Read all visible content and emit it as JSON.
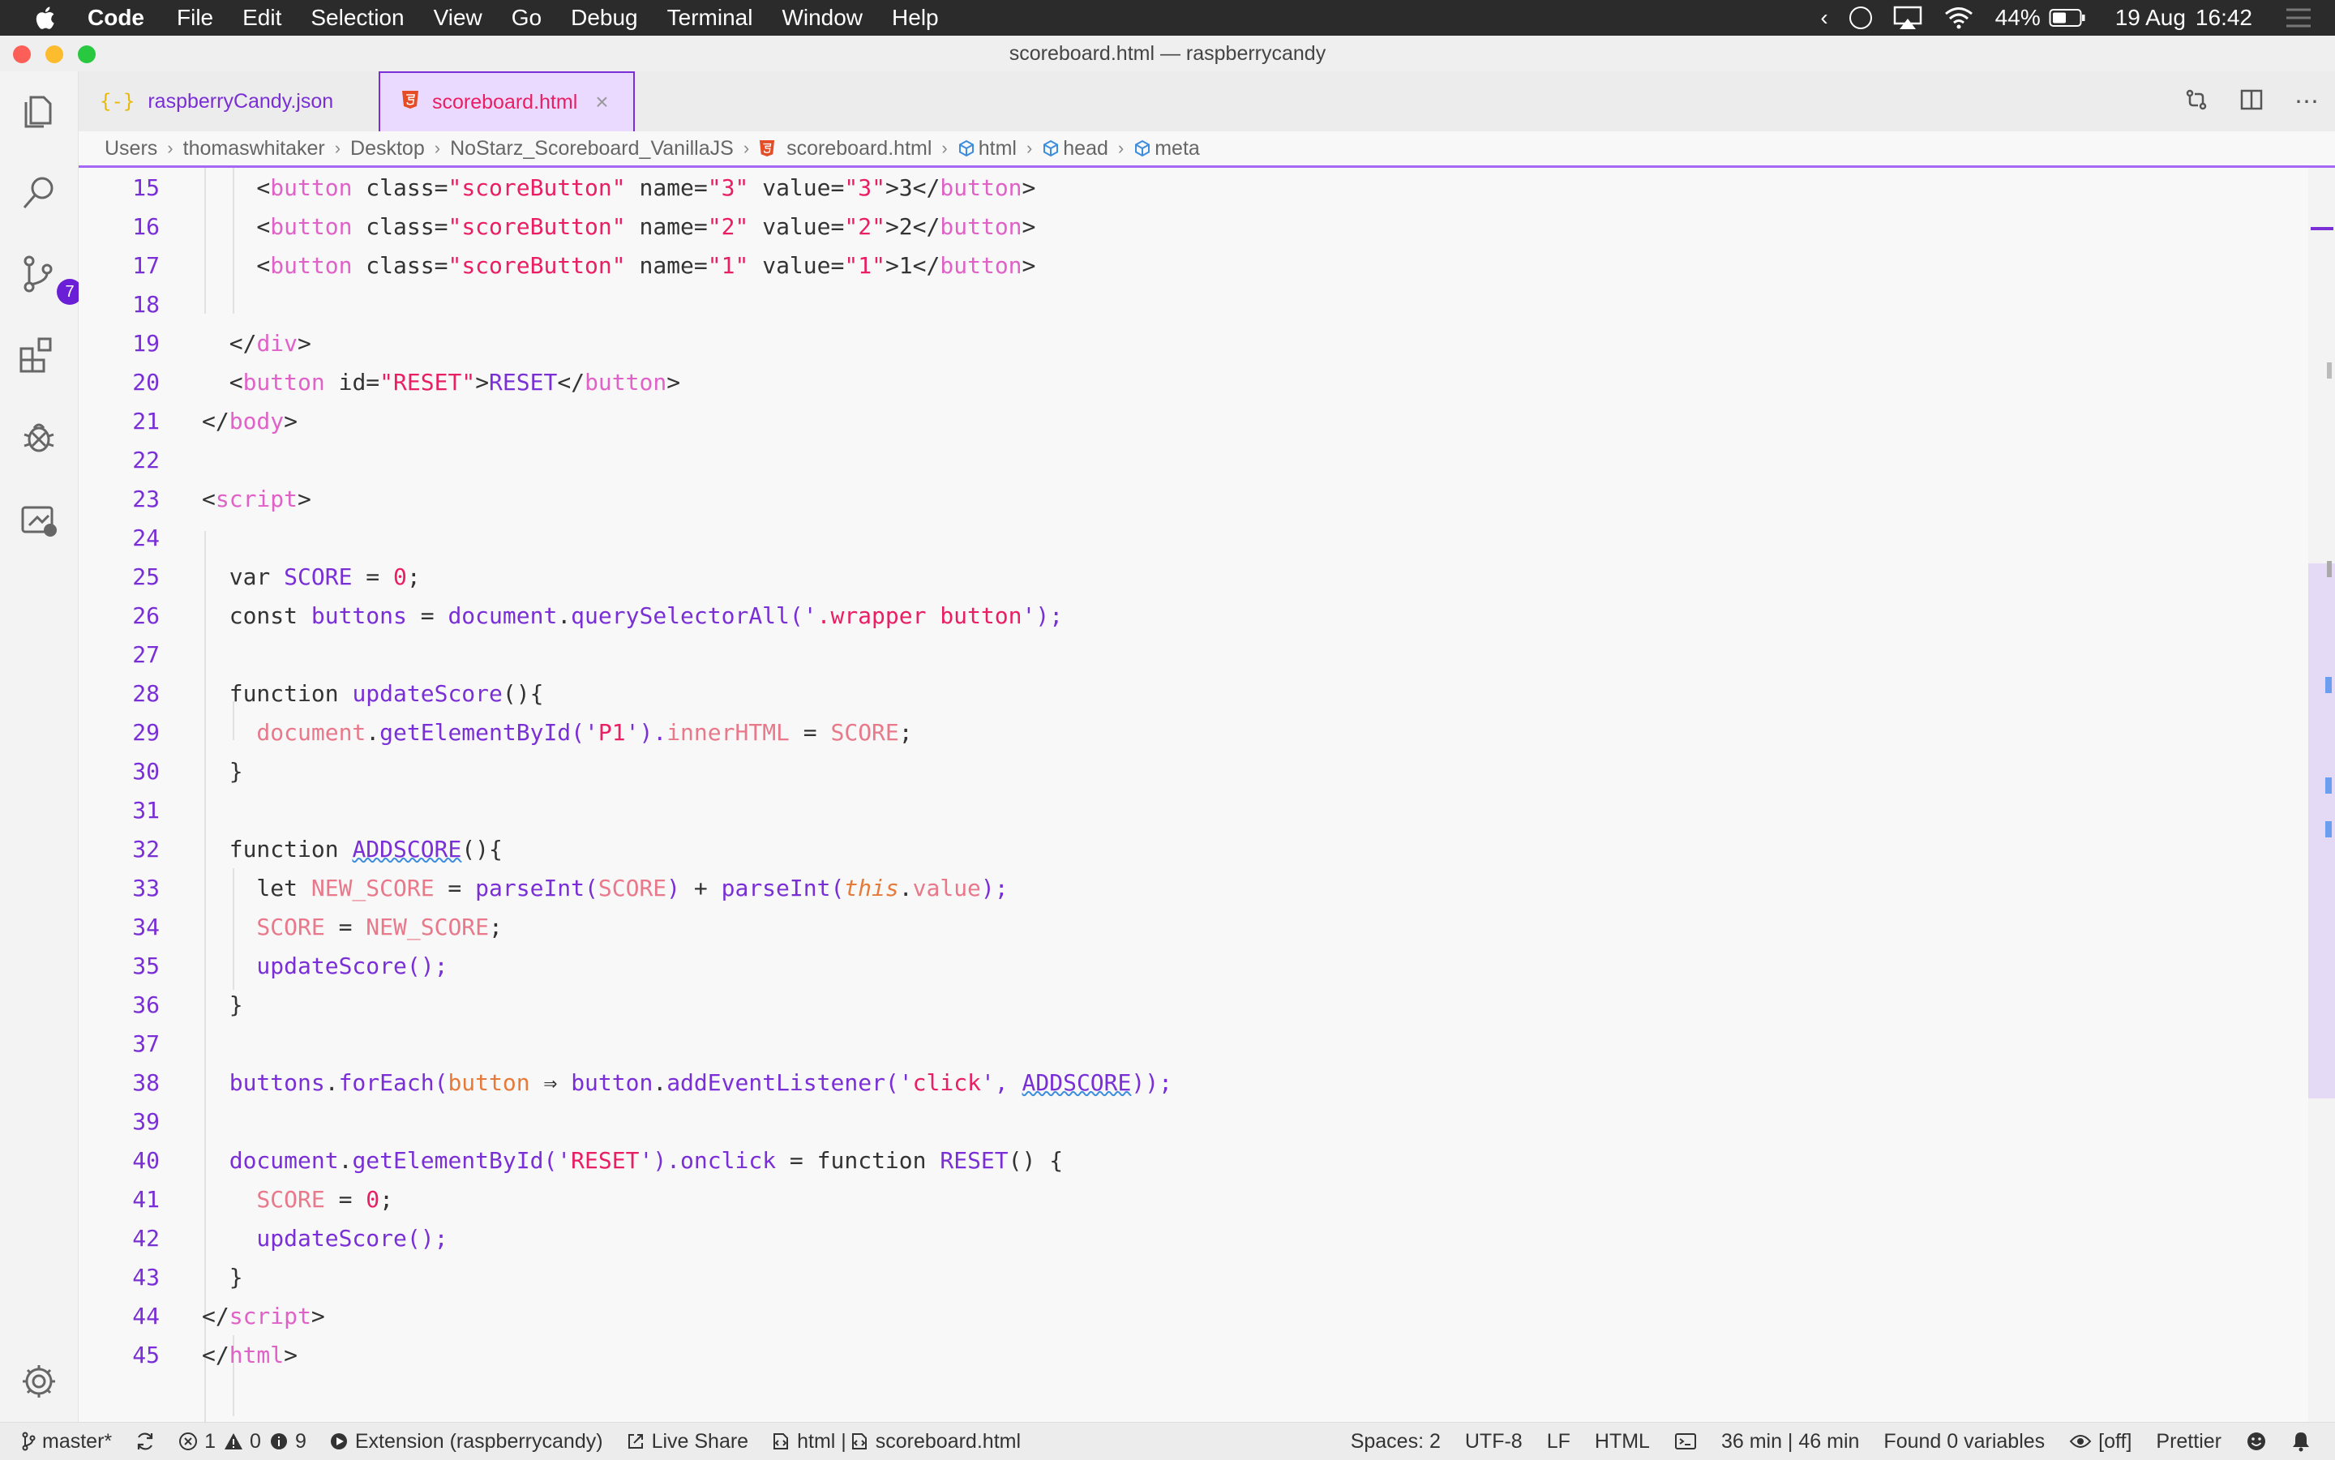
{
  "menubar": {
    "app": "Code",
    "items": [
      "File",
      "Edit",
      "Selection",
      "View",
      "Go",
      "Debug",
      "Terminal",
      "Window",
      "Help"
    ],
    "battery": "44%",
    "date": "19 Aug",
    "time": "16:42"
  },
  "window": {
    "title": "scoreboard.html — raspberrycandy"
  },
  "tabs": [
    {
      "label": "raspberryCandy.json",
      "icon": "json-icon",
      "active": false
    },
    {
      "label": "scoreboard.html",
      "icon": "html5-icon",
      "active": true
    }
  ],
  "breadcrumb": [
    "Users",
    "thomaswhitaker",
    "Desktop",
    "NoStarz_Scoreboard_VanillaJS",
    "scoreboard.html",
    "html",
    "head",
    "meta"
  ],
  "activity": {
    "scm_badge": "7"
  },
  "editor": {
    "line_numbers": [
      "15",
      "16",
      "17",
      "18",
      "19",
      "20",
      "21",
      "22",
      "23",
      "24",
      "25",
      "26",
      "27",
      "28",
      "29",
      "30",
      "31",
      "32",
      "33",
      "34",
      "35",
      "36",
      "37",
      "38",
      "39",
      "40",
      "41",
      "42",
      "43",
      "44",
      "45"
    ],
    "lines": [
      [
        {
          "t": "    <",
          "c": "p"
        },
        {
          "t": "button",
          "c": "tag"
        },
        {
          "t": " class=",
          "c": "attr"
        },
        {
          "t": "\"scoreButton\"",
          "c": "str"
        },
        {
          "t": " name=",
          "c": "attr"
        },
        {
          "t": "\"3\"",
          "c": "str"
        },
        {
          "t": " value=",
          "c": "attr"
        },
        {
          "t": "\"3\"",
          "c": "str"
        },
        {
          "t": ">3</",
          "c": "p"
        },
        {
          "t": "button",
          "c": "tag"
        },
        {
          "t": ">",
          "c": "p"
        }
      ],
      [
        {
          "t": "    <",
          "c": "p"
        },
        {
          "t": "button",
          "c": "tag"
        },
        {
          "t": " class=",
          "c": "attr"
        },
        {
          "t": "\"scoreButton\"",
          "c": "str"
        },
        {
          "t": " name=",
          "c": "attr"
        },
        {
          "t": "\"2\"",
          "c": "str"
        },
        {
          "t": " value=",
          "c": "attr"
        },
        {
          "t": "\"2\"",
          "c": "str"
        },
        {
          "t": ">2</",
          "c": "p"
        },
        {
          "t": "button",
          "c": "tag"
        },
        {
          "t": ">",
          "c": "p"
        }
      ],
      [
        {
          "t": "    <",
          "c": "p"
        },
        {
          "t": "button",
          "c": "tag"
        },
        {
          "t": " class=",
          "c": "attr"
        },
        {
          "t": "\"scoreButton\"",
          "c": "str"
        },
        {
          "t": " name=",
          "c": "attr"
        },
        {
          "t": "\"1\"",
          "c": "str"
        },
        {
          "t": " value=",
          "c": "attr"
        },
        {
          "t": "\"1\"",
          "c": "str"
        },
        {
          "t": ">1</",
          "c": "p"
        },
        {
          "t": "button",
          "c": "tag"
        },
        {
          "t": ">",
          "c": "p"
        }
      ],
      [],
      [
        {
          "t": "  </",
          "c": "p"
        },
        {
          "t": "div",
          "c": "tag"
        },
        {
          "t": ">",
          "c": "p"
        }
      ],
      [
        {
          "t": "  <",
          "c": "p"
        },
        {
          "t": "button",
          "c": "tag"
        },
        {
          "t": " id=",
          "c": "attr"
        },
        {
          "t": "\"RESET\"",
          "c": "str"
        },
        {
          "t": ">",
          "c": "p"
        },
        {
          "t": "RESET",
          "c": "var"
        },
        {
          "t": "</",
          "c": "p"
        },
        {
          "t": "button",
          "c": "tag"
        },
        {
          "t": ">",
          "c": "p"
        }
      ],
      [
        {
          "t": "</",
          "c": "p"
        },
        {
          "t": "body",
          "c": "tag"
        },
        {
          "t": ">",
          "c": "p"
        }
      ],
      [],
      [
        {
          "t": "<",
          "c": "p"
        },
        {
          "t": "script",
          "c": "tag"
        },
        {
          "t": ">",
          "c": "p"
        }
      ],
      [],
      [
        {
          "t": "  var ",
          "c": "kw"
        },
        {
          "t": "SCORE",
          "c": "var"
        },
        {
          "t": " = ",
          "c": "p"
        },
        {
          "t": "0",
          "c": "num"
        },
        {
          "t": ";",
          "c": "p"
        }
      ],
      [
        {
          "t": "  const ",
          "c": "kw"
        },
        {
          "t": "buttons",
          "c": "var"
        },
        {
          "t": " = ",
          "c": "p"
        },
        {
          "t": "document",
          "c": "fn"
        },
        {
          "t": ".",
          "c": "p"
        },
        {
          "t": "querySelectorAll",
          "c": "fn"
        },
        {
          "t": "('",
          "c": "fn"
        },
        {
          "t": ".wrapper button",
          "c": "str"
        },
        {
          "t": "');",
          "c": "fn"
        }
      ],
      [],
      [
        {
          "t": "  function ",
          "c": "kw"
        },
        {
          "t": "updateScore",
          "c": "fn"
        },
        {
          "t": "(){",
          "c": "p"
        }
      ],
      [
        {
          "t": "    document",
          "c": "prop"
        },
        {
          "t": ".",
          "c": "p"
        },
        {
          "t": "getElementById",
          "c": "fn"
        },
        {
          "t": "('",
          "c": "fn"
        },
        {
          "t": "P1",
          "c": "str"
        },
        {
          "t": "').",
          "c": "fn"
        },
        {
          "t": "innerHTML",
          "c": "prop"
        },
        {
          "t": " = ",
          "c": "p"
        },
        {
          "t": "SCORE",
          "c": "prop"
        },
        {
          "t": ";",
          "c": "p"
        }
      ],
      [
        {
          "t": "  }",
          "c": "p"
        }
      ],
      [],
      [
        {
          "t": "  function ",
          "c": "kw"
        },
        {
          "t": "ADDSCORE",
          "c": "fn",
          "sq": true
        },
        {
          "t": "(){",
          "c": "p"
        }
      ],
      [
        {
          "t": "    let ",
          "c": "kw"
        },
        {
          "t": "NEW_SCORE",
          "c": "prop"
        },
        {
          "t": " = ",
          "c": "p"
        },
        {
          "t": "parseInt",
          "c": "fn"
        },
        {
          "t": "(",
          "c": "fn"
        },
        {
          "t": "SCORE",
          "c": "prop"
        },
        {
          "t": ")",
          "c": "fn"
        },
        {
          "t": " + ",
          "c": "p"
        },
        {
          "t": "parseInt",
          "c": "fn"
        },
        {
          "t": "(",
          "c": "fn"
        },
        {
          "t": "this",
          "c": "this"
        },
        {
          "t": ".",
          "c": "p"
        },
        {
          "t": "value",
          "c": "prop"
        },
        {
          "t": ");",
          "c": "fn"
        }
      ],
      [
        {
          "t": "    SCORE",
          "c": "prop"
        },
        {
          "t": " = ",
          "c": "p"
        },
        {
          "t": "NEW_SCORE",
          "c": "prop"
        },
        {
          "t": ";",
          "c": "p"
        }
      ],
      [
        {
          "t": "    updateScore",
          "c": "fn"
        },
        {
          "t": "();",
          "c": "fn"
        }
      ],
      [
        {
          "t": "  }",
          "c": "p"
        }
      ],
      [],
      [
        {
          "t": "  buttons",
          "c": "fn"
        },
        {
          "t": ".",
          "c": "p"
        },
        {
          "t": "forEach",
          "c": "fn"
        },
        {
          "t": "(",
          "c": "fn"
        },
        {
          "t": "button",
          "c": "param"
        },
        {
          "t": " ⇒ ",
          "c": "p"
        },
        {
          "t": "button",
          "c": "fn"
        },
        {
          "t": ".",
          "c": "p"
        },
        {
          "t": "addEventListener",
          "c": "fn"
        },
        {
          "t": "('",
          "c": "fn"
        },
        {
          "t": "click",
          "c": "str"
        },
        {
          "t": "', ",
          "c": "fn"
        },
        {
          "t": "ADDSCORE",
          "c": "fn",
          "sq": true
        },
        {
          "t": "));",
          "c": "fn"
        }
      ],
      [],
      [
        {
          "t": "  document",
          "c": "fn"
        },
        {
          "t": ".",
          "c": "p"
        },
        {
          "t": "getElementById",
          "c": "fn"
        },
        {
          "t": "('",
          "c": "fn"
        },
        {
          "t": "RESET",
          "c": "str"
        },
        {
          "t": "').",
          "c": "fn"
        },
        {
          "t": "onclick",
          "c": "fn"
        },
        {
          "t": " = ",
          "c": "p"
        },
        {
          "t": "function ",
          "c": "kw"
        },
        {
          "t": "RESET",
          "c": "fn"
        },
        {
          "t": "() {",
          "c": "p"
        }
      ],
      [
        {
          "t": "    SCORE",
          "c": "prop"
        },
        {
          "t": " = ",
          "c": "p"
        },
        {
          "t": "0",
          "c": "num"
        },
        {
          "t": ";",
          "c": "p"
        }
      ],
      [
        {
          "t": "    updateScore",
          "c": "fn"
        },
        {
          "t": "();",
          "c": "fn"
        }
      ],
      [
        {
          "t": "  }",
          "c": "p"
        }
      ],
      [
        {
          "t": "</",
          "c": "p"
        },
        {
          "t": "script",
          "c": "tag"
        },
        {
          "t": ">",
          "c": "p"
        }
      ],
      [
        {
          "t": "</",
          "c": "p"
        },
        {
          "t": "html",
          "c": "tag"
        },
        {
          "t": ">",
          "c": "p"
        }
      ]
    ]
  },
  "statusbar": {
    "branch": "master*",
    "errors": "1",
    "warnings": "0",
    "infos": "9",
    "extension": "Extension (raspberrycandy)",
    "liveshare": "Live Share",
    "lang_context": "html | ",
    "file": "scoreboard.html",
    "spaces": "Spaces: 2",
    "encoding": "UTF-8",
    "eol": "LF",
    "language": "HTML",
    "time_tracker": "36 min | 46 min",
    "variables": "Found 0 variables",
    "view_mode": "[off]",
    "formatter": "Prettier"
  },
  "colors": {
    "accent": "#7a2fd6",
    "tag": "#e062c8",
    "string": "#e91e63",
    "property": "#e8788a"
  }
}
